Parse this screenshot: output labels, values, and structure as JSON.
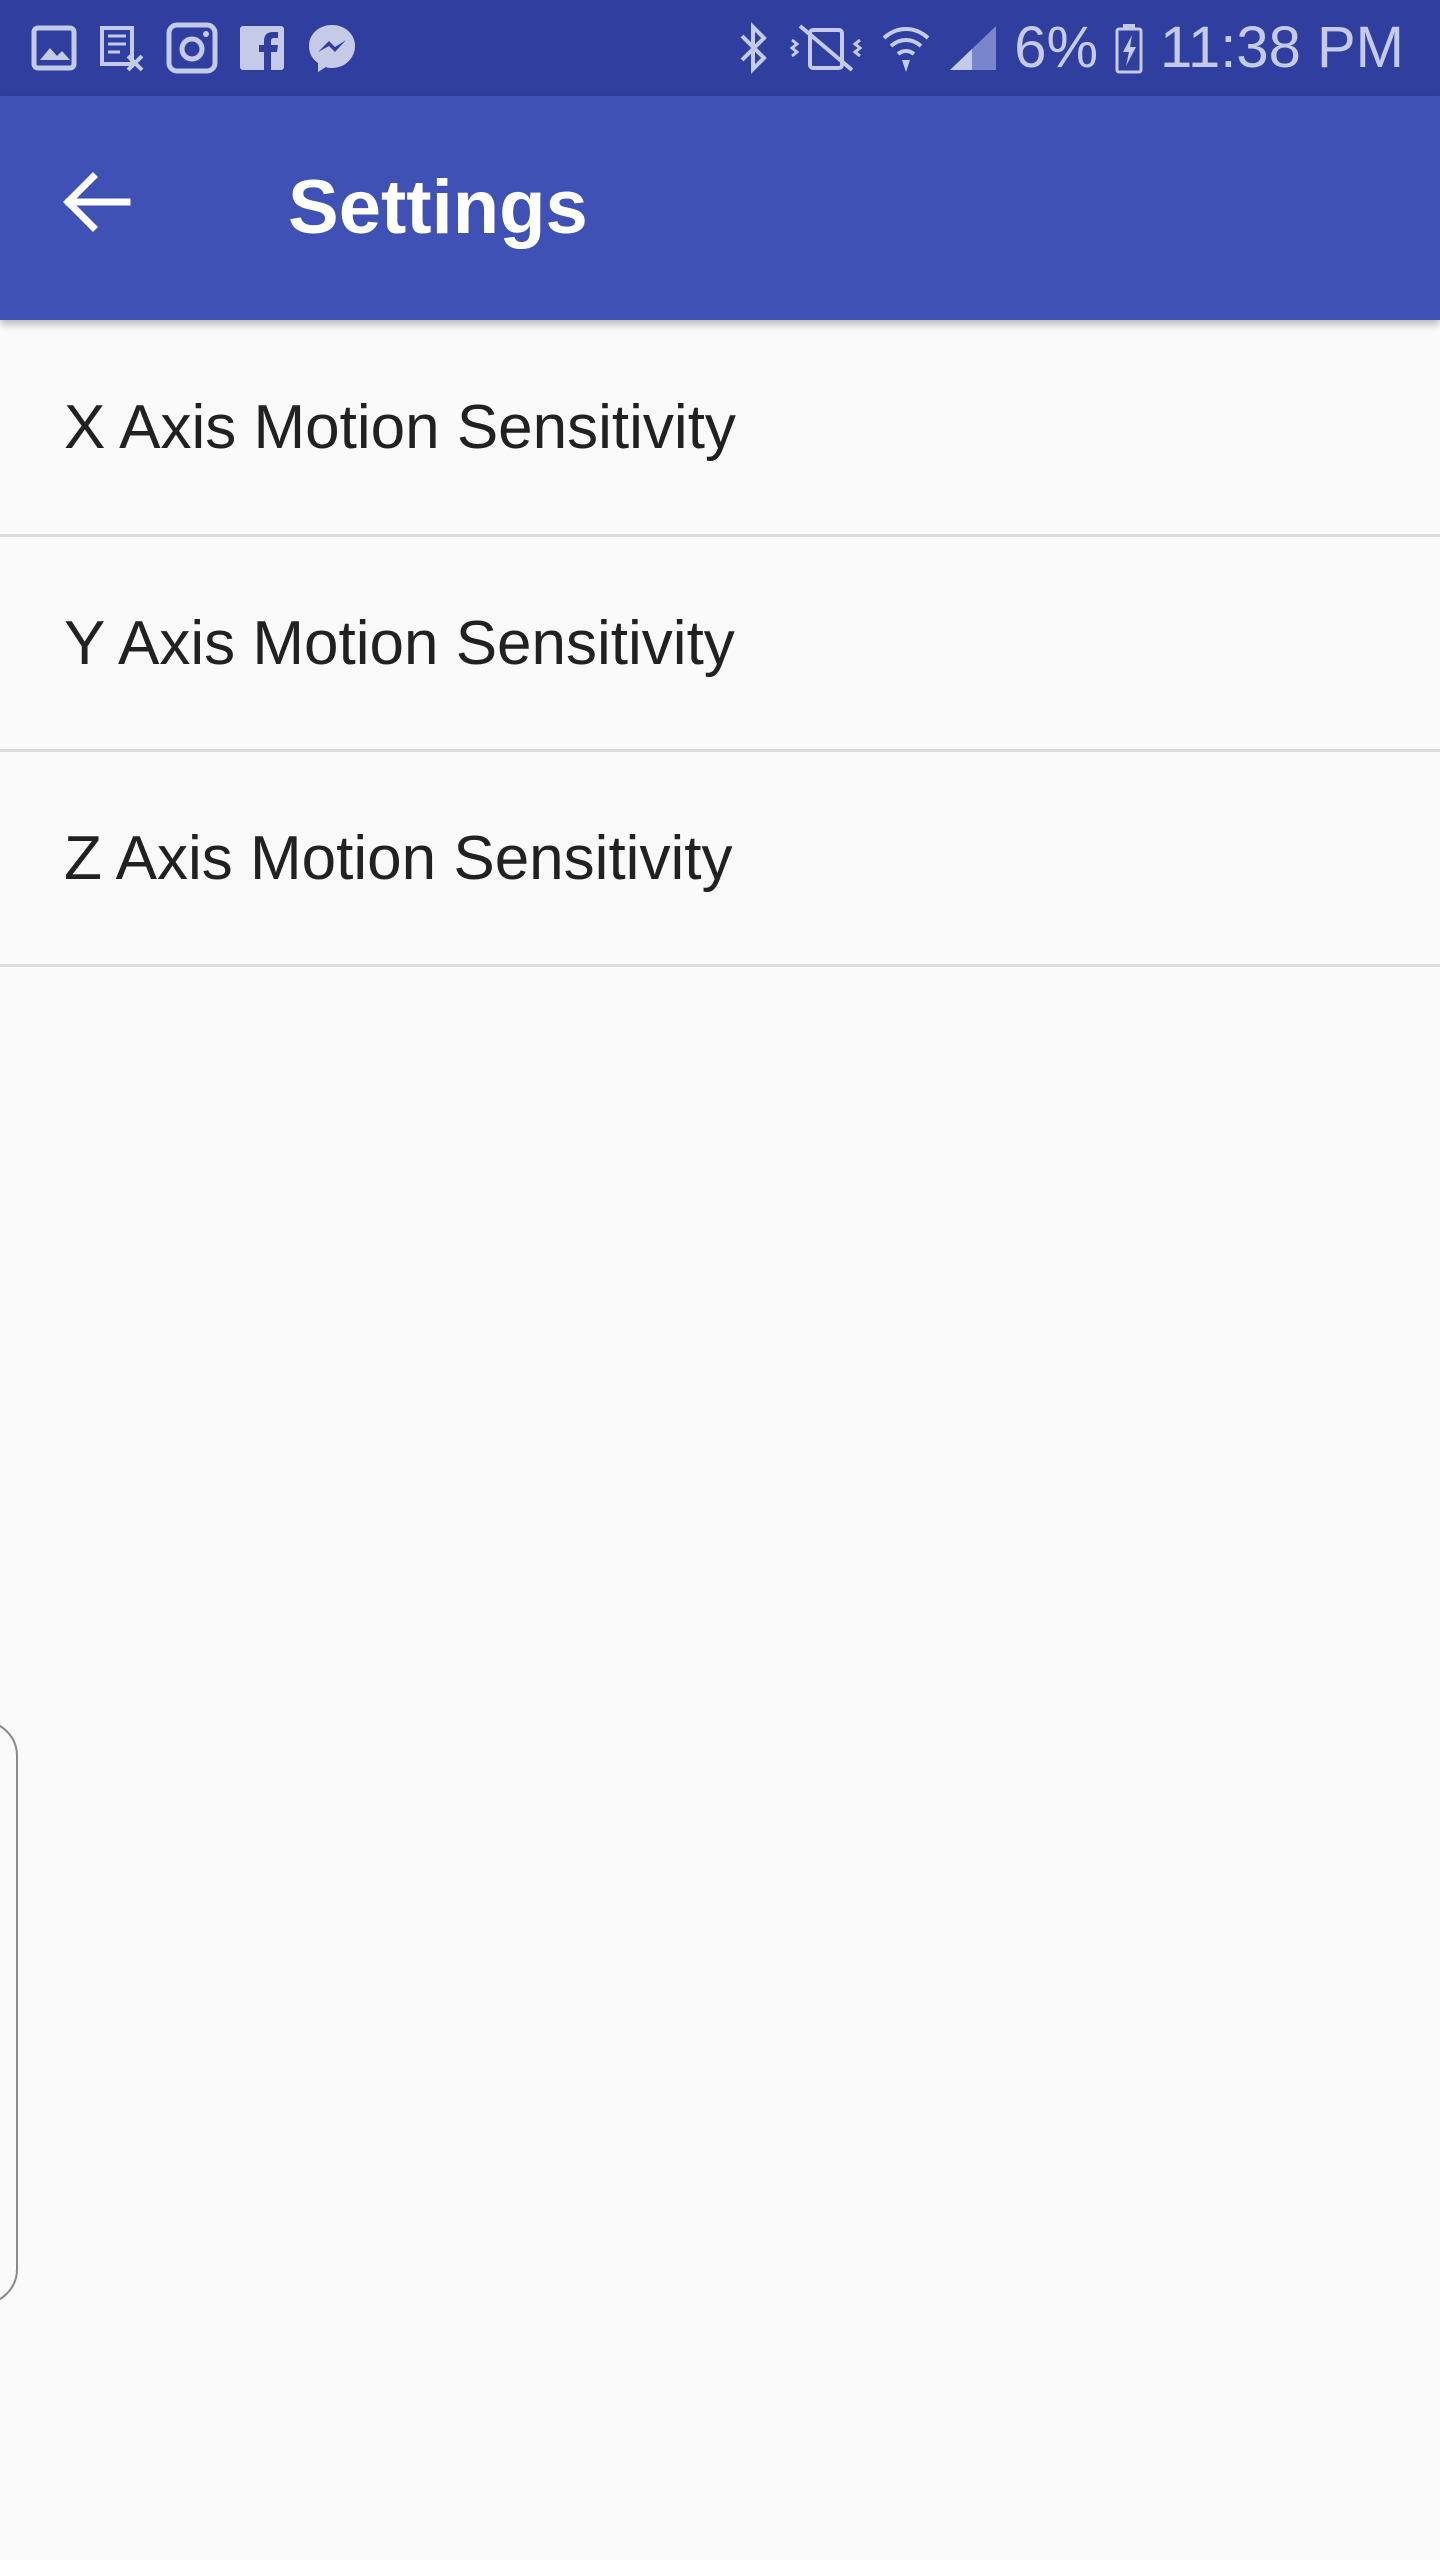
{
  "status_bar": {
    "notification_icons": [
      "gallery-icon",
      "screenshot-icon",
      "instagram-icon",
      "facebook-icon",
      "messenger-icon"
    ],
    "system_icons": [
      "bluetooth-icon",
      "vibrate-mute-icon",
      "wifi-icon",
      "signal-icon"
    ],
    "battery_percent": "6%",
    "time": "11:38 PM",
    "background_color": "#303f9f"
  },
  "app_bar": {
    "title": "Settings",
    "back_icon": "arrow-back-icon",
    "background_color": "#3f51b5"
  },
  "preferences": [
    {
      "label": "X Axis Motion Sensitivity"
    },
    {
      "label": "Y Axis Motion Sensitivity"
    },
    {
      "label": "Z Axis Motion Sensitivity"
    }
  ]
}
